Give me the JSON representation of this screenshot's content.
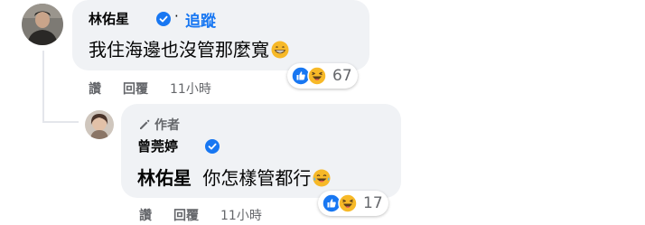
{
  "comment1": {
    "author": "林佑星",
    "follow_label": "追蹤",
    "text": "我住海邊也沒管那麼寬",
    "reaction_count": "67",
    "actions": {
      "like": "讚",
      "reply": "回覆",
      "time": "11小時"
    }
  },
  "comment2": {
    "author_badge": "作者",
    "author": "曾莞婷",
    "mention": "林佑星",
    "text": "你怎樣管都行",
    "reaction_count": "17",
    "actions": {
      "like": "讚",
      "reply": "回覆",
      "time": "11小時"
    }
  },
  "icons": {
    "verified": "verified-badge-icon",
    "like_reaction": "like-reaction-icon",
    "haha_reaction": "haha-reaction-icon",
    "author_badge": "pencil-icon",
    "grin_emoji": "grin-emoji-icon",
    "laugh_tears_emoji": "laugh-tears-emoji-icon"
  },
  "colors": {
    "link_blue": "#1877f2",
    "bubble_bg": "#f0f2f5",
    "meta_gray": "#65676b",
    "reaction_yellow": "#f7b928"
  }
}
